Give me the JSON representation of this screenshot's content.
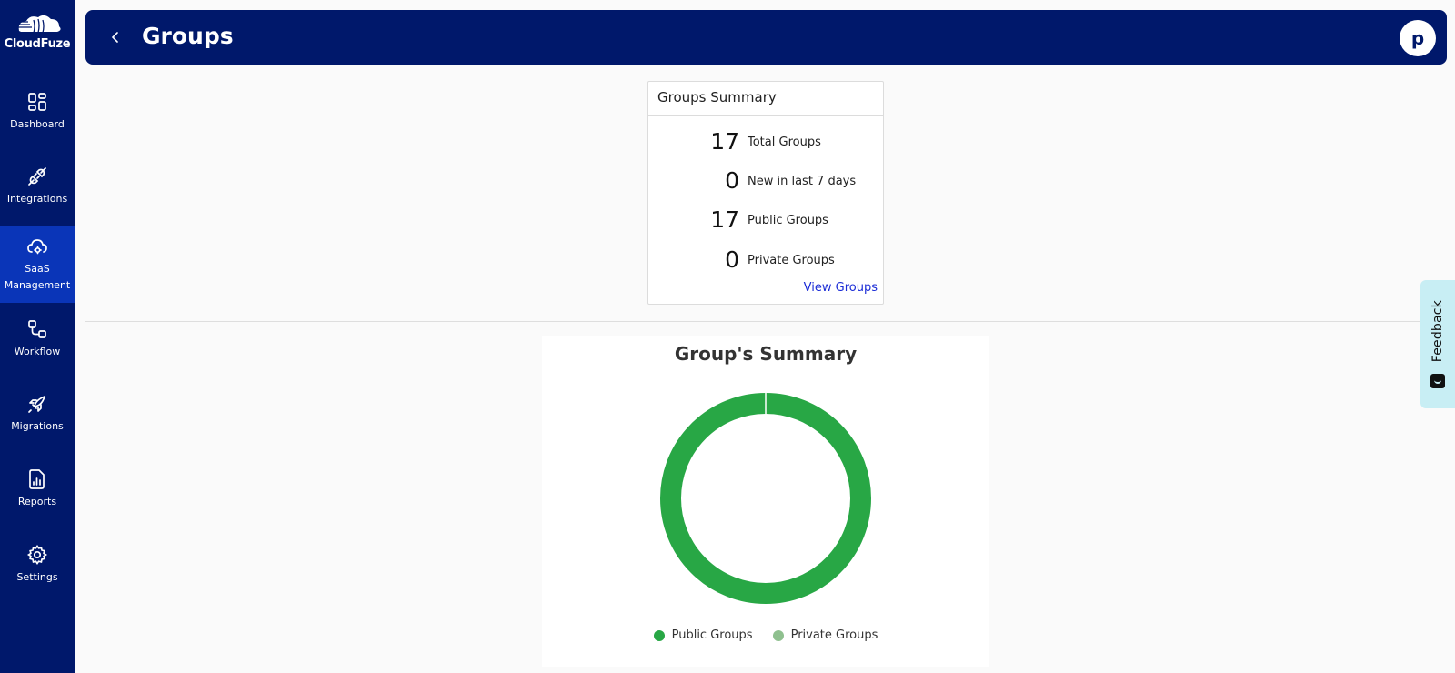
{
  "brand": {
    "name": "CloudFuze"
  },
  "sidebar": {
    "items": [
      {
        "label": "Dashboard",
        "icon": "dashboard-icon"
      },
      {
        "label": "Integrations",
        "icon": "plug-icon"
      },
      {
        "label": "SaaS Management",
        "icon": "cloud-gear-icon",
        "active": true
      },
      {
        "label": "Workflow",
        "icon": "workflow-icon"
      },
      {
        "label": "Migrations",
        "icon": "rocket-icon"
      },
      {
        "label": "Reports",
        "icon": "report-icon"
      },
      {
        "label": "Settings",
        "icon": "gear-icon"
      }
    ]
  },
  "header": {
    "title": "Groups",
    "avatar_initial": "p"
  },
  "summary": {
    "title": "Groups Summary",
    "stats": [
      {
        "value": "17",
        "label": "Total Groups"
      },
      {
        "value": "0",
        "label": "New in last 7 days"
      },
      {
        "value": "17",
        "label": "Public Groups"
      },
      {
        "value": "0",
        "label": "Private Groups"
      }
    ],
    "link": "View Groups"
  },
  "chart_data": {
    "type": "pie",
    "title": "Group's Summary",
    "categories": [
      "Public Groups",
      "Private Groups"
    ],
    "values": [
      17,
      0
    ],
    "colors": [
      "#28a745",
      "#8fc08f"
    ],
    "legend_position": "bottom"
  },
  "feedback": {
    "label": "Feedback"
  },
  "colors": {
    "primary": "#00186b",
    "active": "#0a35b8",
    "accent": "#28a745"
  }
}
